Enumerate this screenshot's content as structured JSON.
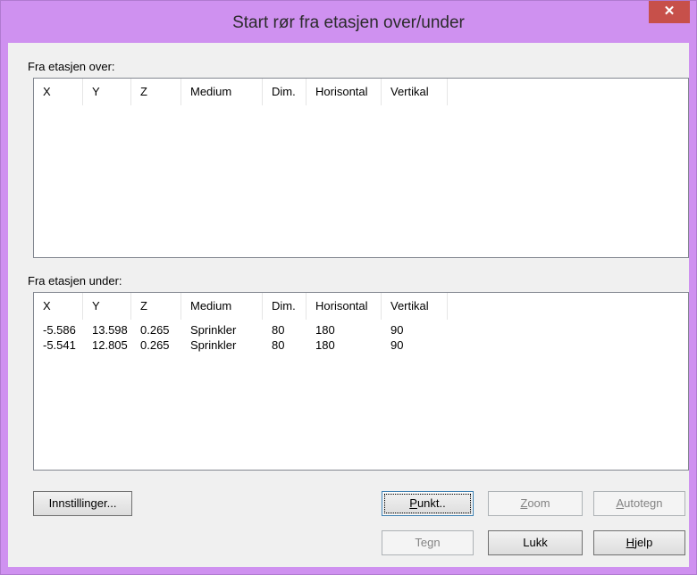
{
  "window": {
    "title": "Start rør fra etasjen over/under",
    "close_glyph": "✕",
    "accent_color": "#cf91f0"
  },
  "columns": [
    "X",
    "Y",
    "Z",
    "Medium",
    "Dim.",
    "Horisontal",
    "Vertikal"
  ],
  "above": {
    "label": "Fra etasjen over:",
    "rows": []
  },
  "below": {
    "label": "Fra etasjen under:",
    "rows": [
      [
        "-5.586",
        "13.598",
        "0.265",
        "Sprinkler",
        "80",
        "180",
        "90"
      ],
      [
        "-5.541",
        "12.805",
        "0.265",
        "Sprinkler",
        "80",
        "180",
        "90"
      ]
    ]
  },
  "buttons": {
    "settings": "Innstillinger...",
    "point": "Punkt..",
    "zoom": "Zoom",
    "autodraw": "Autotegn",
    "draw": "Tegn",
    "close": "Lukk",
    "help": "Hjelp"
  }
}
